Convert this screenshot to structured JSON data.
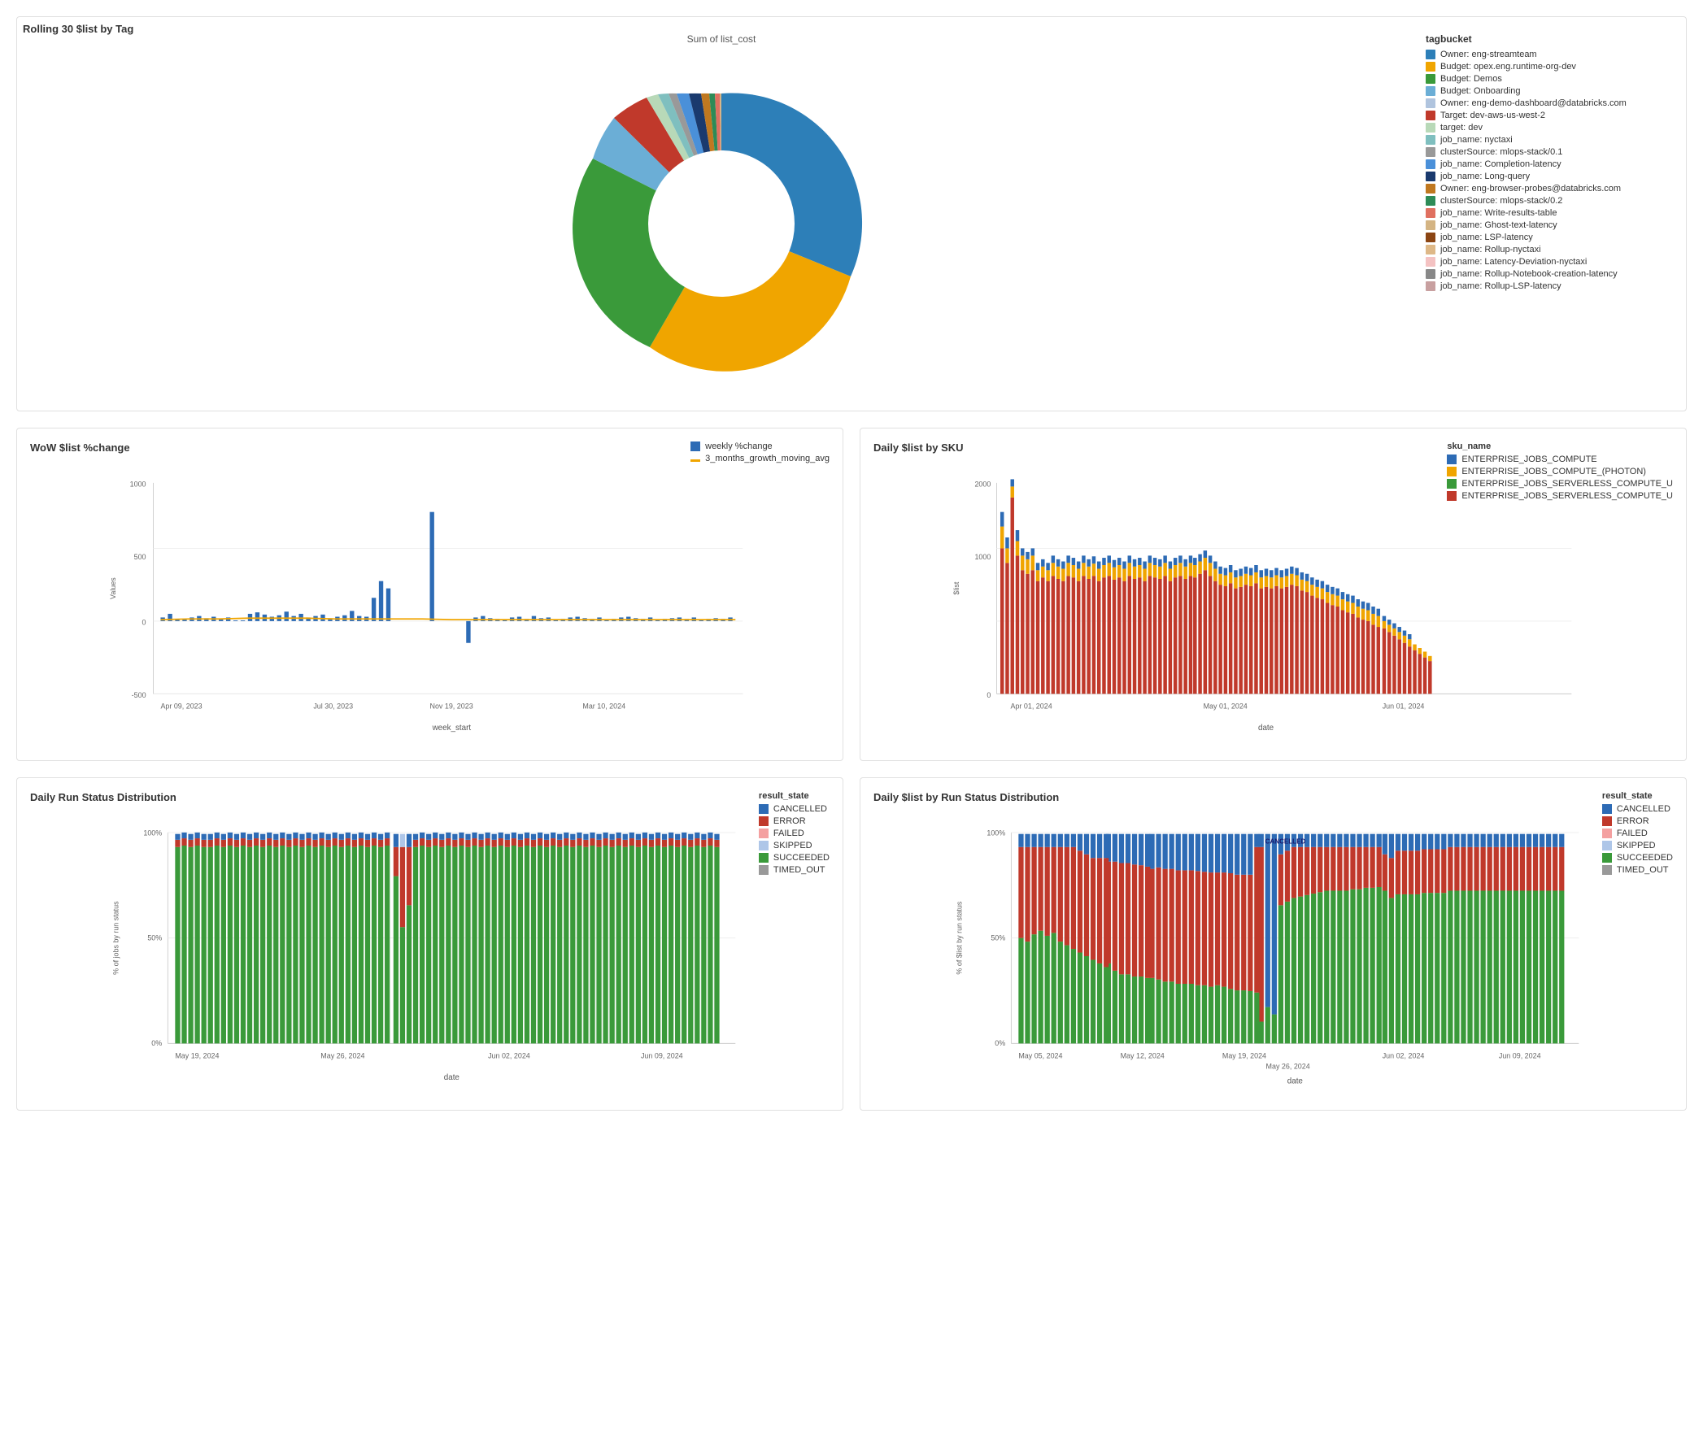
{
  "top": {
    "title": "Rolling 30 $list by Tag",
    "donut_subtitle": "Sum of list_cost",
    "legend_title": "tagbucket",
    "legend_items": [
      {
        "label": "Owner: eng-streamteam",
        "color": "#2d7fb8"
      },
      {
        "label": "Budget: opex.eng.runtime-org-dev",
        "color": "#f0a500"
      },
      {
        "label": "Budget: Demos",
        "color": "#3a9a3a"
      },
      {
        "label": "Budget: Onboarding",
        "color": "#6baed6"
      },
      {
        "label": "Owner: eng-demo-dashboard@databricks.com",
        "color": "#b0c4de"
      },
      {
        "label": "Target: dev-aws-us-west-2",
        "color": "#c0392b"
      },
      {
        "label": "target: dev",
        "color": "#b8d9b8"
      },
      {
        "label": "job_name: nyctaxi",
        "color": "#7fbfbf"
      },
      {
        "label": "clusterSource: mlops-stack/0.1",
        "color": "#999999"
      },
      {
        "label": "job_name: Completion-latency",
        "color": "#4a90d9"
      },
      {
        "label": "job_name: Long-query",
        "color": "#1a3a6e"
      },
      {
        "label": "Owner: eng-browser-probes@databricks.com",
        "color": "#c07820"
      },
      {
        "label": "clusterSource: mlops-stack/0.2",
        "color": "#2e8b57"
      },
      {
        "label": "job_name: Write-results-table",
        "color": "#e07060"
      },
      {
        "label": "job_name: Ghost-text-latency",
        "color": "#d4b483"
      },
      {
        "label": "job_name: LSP-latency",
        "color": "#8b4513"
      },
      {
        "label": "job_name: Rollup-nyctaxi",
        "color": "#deb887"
      },
      {
        "label": "job_name: Latency-Deviation-nyctaxi",
        "color": "#f4c2c2"
      },
      {
        "label": "job_name: Rollup-Notebook-creation-latency",
        "color": "#888888"
      },
      {
        "label": "job_name: Rollup-LSP-latency",
        "color": "#c8a0a0"
      }
    ]
  },
  "wow": {
    "title": "WoW $list %change",
    "x_label": "week_start",
    "y_label": "Values",
    "legend": [
      {
        "label": "weekly %change",
        "color": "#2d6bb5"
      },
      {
        "label": "3_months_growth_moving_avg",
        "color": "#f0a500"
      }
    ],
    "x_ticks": [
      "Apr 09, 2023",
      "Jul 30, 2023",
      "Nov 19, 2023",
      "Mar 10, 2024"
    ],
    "y_ticks": [
      "-500",
      "0",
      "500",
      "1000"
    ]
  },
  "daily_sku": {
    "title": "Daily $list by SKU",
    "x_label": "date",
    "y_label": "$list",
    "legend_title": "sku_name",
    "legend_items": [
      {
        "label": "ENTERPRISE_JOBS_COMPUTE",
        "color": "#2d6bb5"
      },
      {
        "label": "ENTERPRISE_JOBS_COMPUTE_(PHOTON)",
        "color": "#f0a500"
      },
      {
        "label": "ENTERPRISE_JOBS_SERVERLESS_COMPUTE_U",
        "color": "#3a9a3a"
      },
      {
        "label": "ENTERPRISE_JOBS_SERVERLESS_COMPUTE_U",
        "color": "#c0392b"
      }
    ],
    "x_ticks": [
      "Apr 01, 2024",
      "May 01, 2024",
      "Jun 01, 2024"
    ],
    "y_ticks": [
      "0",
      "1000",
      "2000"
    ]
  },
  "daily_run": {
    "title": "Daily Run Status Distribution",
    "x_label": "date",
    "y_label": "% of jobs by run status",
    "legend_title": "result_state",
    "legend_items": [
      {
        "label": "CANCELLED",
        "color": "#2d6bb5"
      },
      {
        "label": "ERROR",
        "color": "#c0392b"
      },
      {
        "label": "FAILED",
        "color": "#f4a0a0"
      },
      {
        "label": "SKIPPED",
        "color": "#aec6e8"
      },
      {
        "label": "SUCCEEDED",
        "color": "#3a9a3a"
      },
      {
        "label": "TIMED_OUT",
        "color": "#999999"
      }
    ],
    "x_ticks": [
      "May 19, 2024",
      "May 26, 2024",
      "Jun 02, 2024",
      "Jun 09, 2024"
    ],
    "y_ticks": [
      "0%",
      "50%",
      "100%"
    ]
  },
  "daily_list_run": {
    "title": "Daily $list by Run Status Distribution",
    "x_label": "date",
    "y_label": "% of $list by run status",
    "legend_title": "result_state",
    "legend_items": [
      {
        "label": "CANCELLED",
        "color": "#2d6bb5"
      },
      {
        "label": "ERROR",
        "color": "#c0392b"
      },
      {
        "label": "FAILED",
        "color": "#f4a0a0"
      },
      {
        "label": "SKIPPED",
        "color": "#aec6e8"
      },
      {
        "label": "SUCCEEDED",
        "color": "#3a9a3a"
      },
      {
        "label": "TIMED_OUT",
        "color": "#999999"
      }
    ],
    "x_ticks": [
      "May 05, 2024",
      "May 12, 2024",
      "May 19, 2024",
      "May 26, 2024",
      "Jun 02, 2024",
      "Jun 09, 2024"
    ],
    "y_ticks": [
      "0%",
      "50%",
      "100%"
    ]
  }
}
